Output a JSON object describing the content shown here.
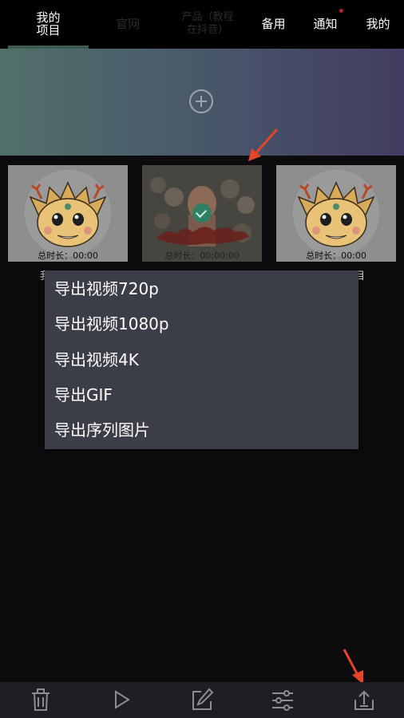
{
  "tabs": [
    {
      "label": "我的\n项目",
      "active": true
    },
    {
      "label": "官网",
      "active": false
    },
    {
      "label": "产品（教程\n在抖音）",
      "active": false
    },
    {
      "label": "备用",
      "active": false
    },
    {
      "label": "通知",
      "active": false,
      "has_dot": true
    },
    {
      "label": "我的",
      "active": false
    }
  ],
  "projects": [
    {
      "duration": "总时长：00:00",
      "caption": "我"
    },
    {
      "duration": "总时长：00:00:00",
      "caption": ""
    },
    {
      "duration": "总时长：00:00",
      "caption": "目"
    }
  ],
  "export_menu": {
    "items": [
      "导出视频720p",
      "导出视频1080p",
      "导出视频4K",
      "导出GIF",
      "导出序列图片"
    ]
  },
  "bottom_toolbar": {
    "icons": [
      "trash-icon",
      "play-icon",
      "edit-icon",
      "sliders-icon",
      "export-icon"
    ]
  },
  "colors": {
    "accent_underline": "#3d5a50",
    "notify_dot": "#b5202a",
    "annotation_arrow": "#e5442a",
    "menu_bg": "#3b3e47"
  }
}
